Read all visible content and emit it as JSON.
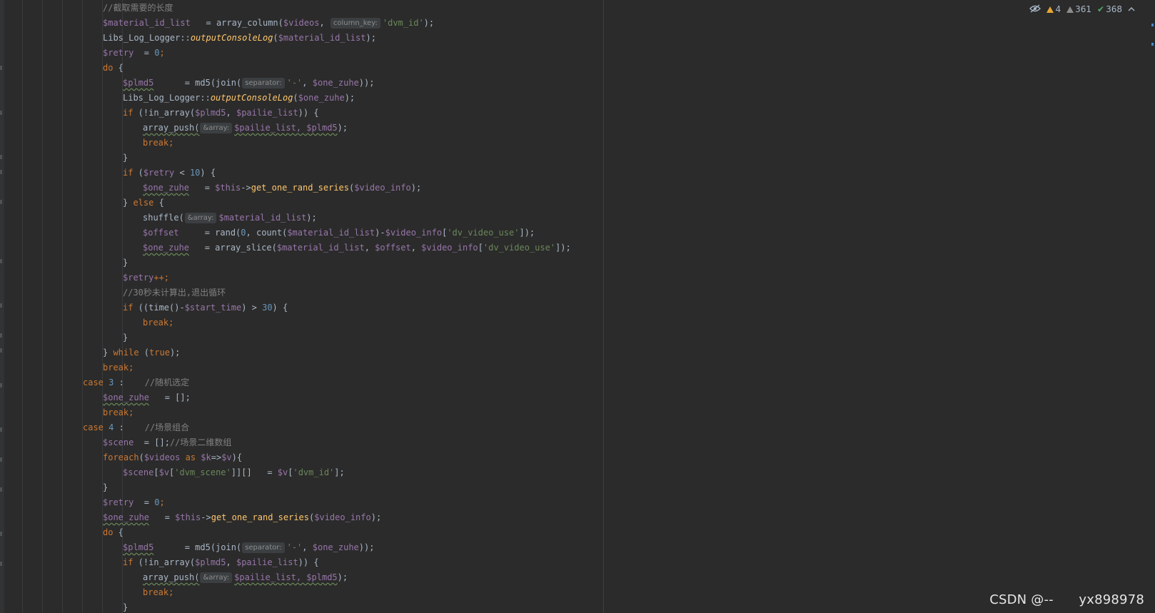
{
  "inspection_widget": {
    "warnings_count": "4",
    "weak_warnings_count": "361",
    "typos_count": "368"
  },
  "watermark": "CSDN @--      yx898978",
  "colors": {
    "background": "#2b2b2b",
    "variable": "#9876aa",
    "keyword": "#cc7832",
    "string": "#6a8759",
    "number": "#6897bb",
    "function": "#ffc66d",
    "comment": "#808080",
    "default": "#a9b7c6"
  },
  "code_lines": [
    [
      {
        "t": "//截取需要的长度",
        "c": "cmt"
      }
    ],
    [
      {
        "t": "$material_id_list",
        "c": "var"
      },
      {
        "t": "   = array_column(",
        "c": "plain"
      },
      {
        "t": "$videos",
        "c": "var"
      },
      {
        "t": ", ",
        "c": "plain"
      },
      {
        "t": "column_key:",
        "c": "hint"
      },
      {
        "t": "'dvm_id'",
        "c": "str"
      },
      {
        "t": ");",
        "c": "plain"
      }
    ],
    [
      {
        "t": "Libs_Log_Logger::",
        "c": "plain"
      },
      {
        "t": "outputConsoleLog",
        "c": "sfn"
      },
      {
        "t": "(",
        "c": "plain"
      },
      {
        "t": "$material_id_list",
        "c": "var"
      },
      {
        "t": ");",
        "c": "plain"
      }
    ],
    [
      {
        "t": "$retry",
        "c": "var"
      },
      {
        "t": "  = ",
        "c": "plain"
      },
      {
        "t": "0",
        "c": "num"
      },
      {
        "t": ";",
        "c": "kw"
      }
    ],
    [
      {
        "t": "do",
        "c": "kw"
      },
      {
        "t": " {",
        "c": "plain"
      }
    ],
    [
      {
        "t": "$plmd5",
        "c": "var wavy"
      },
      {
        "t": "      = md5(join(",
        "c": "plain"
      },
      {
        "t": "separator:",
        "c": "hint"
      },
      {
        "t": "'-'",
        "c": "str"
      },
      {
        "t": ", ",
        "c": "plain"
      },
      {
        "t": "$one_zuhe",
        "c": "var"
      },
      {
        "t": "));",
        "c": "plain"
      }
    ],
    [
      {
        "t": "Libs_Log_Logger::",
        "c": "plain"
      },
      {
        "t": "outputConsoleLog",
        "c": "sfn"
      },
      {
        "t": "(",
        "c": "plain"
      },
      {
        "t": "$one_zuhe",
        "c": "var"
      },
      {
        "t": ");",
        "c": "plain"
      }
    ],
    [
      {
        "t": "if",
        "c": "kw"
      },
      {
        "t": " (!in_array(",
        "c": "plain"
      },
      {
        "t": "$plmd5",
        "c": "var"
      },
      {
        "t": ", ",
        "c": "plain"
      },
      {
        "t": "$pailie_list",
        "c": "var"
      },
      {
        "t": ")) {",
        "c": "plain"
      }
    ],
    [
      {
        "t": "array_push(",
        "c": "plain wavy"
      },
      {
        "t": "&array:",
        "c": "hint"
      },
      {
        "t": "$pailie_list, $plmd5",
        "c": "var wavy"
      },
      {
        "t": ");",
        "c": "plain"
      }
    ],
    [
      {
        "t": "break;",
        "c": "kw"
      }
    ],
    [
      {
        "t": "}",
        "c": "plain"
      }
    ],
    [
      {
        "t": "if",
        "c": "kw"
      },
      {
        "t": " (",
        "c": "plain"
      },
      {
        "t": "$retry",
        "c": "var"
      },
      {
        "t": " < ",
        "c": "plain"
      },
      {
        "t": "10",
        "c": "num"
      },
      {
        "t": ") {",
        "c": "plain"
      }
    ],
    [
      {
        "t": "$one_zuhe",
        "c": "var wavy"
      },
      {
        "t": "   = ",
        "c": "plain"
      },
      {
        "t": "$this",
        "c": "var"
      },
      {
        "t": "->",
        "c": "plain"
      },
      {
        "t": "get_one_rand_series",
        "c": "fn"
      },
      {
        "t": "(",
        "c": "plain"
      },
      {
        "t": "$video_info",
        "c": "var"
      },
      {
        "t": ");",
        "c": "plain"
      }
    ],
    [
      {
        "t": "} ",
        "c": "plain"
      },
      {
        "t": "else",
        "c": "kw"
      },
      {
        "t": " {",
        "c": "plain"
      }
    ],
    [
      {
        "t": "shuffle(",
        "c": "plain"
      },
      {
        "t": "&array:",
        "c": "hint"
      },
      {
        "t": "$material_id_list",
        "c": "var"
      },
      {
        "t": ");",
        "c": "plain"
      }
    ],
    [
      {
        "t": "$offset",
        "c": "var"
      },
      {
        "t": "     = rand(",
        "c": "plain"
      },
      {
        "t": "0",
        "c": "num"
      },
      {
        "t": ", count(",
        "c": "plain"
      },
      {
        "t": "$material_id_list",
        "c": "var"
      },
      {
        "t": ")-",
        "c": "plain"
      },
      {
        "t": "$video_info",
        "c": "var"
      },
      {
        "t": "[",
        "c": "plain"
      },
      {
        "t": "'dv_video_use'",
        "c": "str"
      },
      {
        "t": "]);",
        "c": "plain"
      }
    ],
    [
      {
        "t": "$one_zuhe",
        "c": "var wavy"
      },
      {
        "t": "   = array_slice(",
        "c": "plain"
      },
      {
        "t": "$material_id_list",
        "c": "var"
      },
      {
        "t": ", ",
        "c": "plain"
      },
      {
        "t": "$offset",
        "c": "var"
      },
      {
        "t": ", ",
        "c": "plain"
      },
      {
        "t": "$video_info",
        "c": "var"
      },
      {
        "t": "[",
        "c": "plain"
      },
      {
        "t": "'dv_video_use'",
        "c": "str"
      },
      {
        "t": "]);",
        "c": "plain"
      }
    ],
    [
      {
        "t": "}",
        "c": "plain"
      }
    ],
    [
      {
        "t": "$retry",
        "c": "var"
      },
      {
        "t": "++;",
        "c": "kw"
      }
    ],
    [
      {
        "t": "//30秒未计算出,退出循环",
        "c": "cmt"
      }
    ],
    [
      {
        "t": "if",
        "c": "kw"
      },
      {
        "t": " ((time()-",
        "c": "plain"
      },
      {
        "t": "$start_time",
        "c": "var"
      },
      {
        "t": ") > ",
        "c": "plain"
      },
      {
        "t": "30",
        "c": "num"
      },
      {
        "t": ") {",
        "c": "plain"
      }
    ],
    [
      {
        "t": "break;",
        "c": "kw"
      }
    ],
    [
      {
        "t": "}",
        "c": "plain"
      }
    ],
    [
      {
        "t": "} ",
        "c": "plain"
      },
      {
        "t": "while",
        "c": "kw"
      },
      {
        "t": " (",
        "c": "plain"
      },
      {
        "t": "true",
        "c": "kw"
      },
      {
        "t": ");",
        "c": "plain"
      }
    ],
    [
      {
        "t": "break;",
        "c": "kw"
      }
    ],
    [
      {
        "t": "case",
        "c": "kw"
      },
      {
        "t": " ",
        "c": "plain"
      },
      {
        "t": "3",
        "c": "num"
      },
      {
        "t": " :    ",
        "c": "plain"
      },
      {
        "t": "//随机选定",
        "c": "cmt"
      }
    ],
    [
      {
        "t": "$one_zuhe",
        "c": "var wavy"
      },
      {
        "t": "   = [];",
        "c": "plain"
      }
    ],
    [
      {
        "t": "break;",
        "c": "kw"
      }
    ],
    [
      {
        "t": "case",
        "c": "kw"
      },
      {
        "t": " ",
        "c": "plain"
      },
      {
        "t": "4",
        "c": "num"
      },
      {
        "t": " :    ",
        "c": "plain"
      },
      {
        "t": "//场景组合",
        "c": "cmt"
      }
    ],
    [
      {
        "t": "$scene",
        "c": "var"
      },
      {
        "t": "  = [];",
        "c": "plain"
      },
      {
        "t": "//场景二维数组",
        "c": "cmt"
      }
    ],
    [
      {
        "t": "foreach",
        "c": "kw"
      },
      {
        "t": "(",
        "c": "plain"
      },
      {
        "t": "$videos",
        "c": "var"
      },
      {
        "t": " as ",
        "c": "kw"
      },
      {
        "t": "$k",
        "c": "var"
      },
      {
        "t": "=>",
        "c": "plain"
      },
      {
        "t": "$v",
        "c": "var"
      },
      {
        "t": "){",
        "c": "plain"
      }
    ],
    [
      {
        "t": "$scene",
        "c": "var"
      },
      {
        "t": "[",
        "c": "plain"
      },
      {
        "t": "$v",
        "c": "var"
      },
      {
        "t": "[",
        "c": "plain"
      },
      {
        "t": "'dvm_scene'",
        "c": "str"
      },
      {
        "t": "]][]   = ",
        "c": "plain"
      },
      {
        "t": "$v",
        "c": "var"
      },
      {
        "t": "[",
        "c": "plain"
      },
      {
        "t": "'dvm_id'",
        "c": "str"
      },
      {
        "t": "];",
        "c": "plain"
      }
    ],
    [
      {
        "t": "}",
        "c": "plain"
      }
    ],
    [
      {
        "t": "$retry",
        "c": "var"
      },
      {
        "t": "  = ",
        "c": "plain"
      },
      {
        "t": "0",
        "c": "num"
      },
      {
        "t": ";",
        "c": "kw"
      }
    ],
    [
      {
        "t": "$one_zuhe",
        "c": "var wavy"
      },
      {
        "t": "   = ",
        "c": "plain"
      },
      {
        "t": "$this",
        "c": "var"
      },
      {
        "t": "->",
        "c": "plain"
      },
      {
        "t": "get_one_rand_series",
        "c": "fn"
      },
      {
        "t": "(",
        "c": "plain"
      },
      {
        "t": "$video_info",
        "c": "var"
      },
      {
        "t": ");",
        "c": "plain"
      }
    ],
    [
      {
        "t": "do",
        "c": "kw"
      },
      {
        "t": " {",
        "c": "plain"
      }
    ],
    [
      {
        "t": "$plmd5",
        "c": "var wavy"
      },
      {
        "t": "      = md5(join(",
        "c": "plain"
      },
      {
        "t": "separator:",
        "c": "hint"
      },
      {
        "t": "'-'",
        "c": "str"
      },
      {
        "t": ", ",
        "c": "plain"
      },
      {
        "t": "$one_zuhe",
        "c": "var"
      },
      {
        "t": "));",
        "c": "plain"
      }
    ],
    [
      {
        "t": "if",
        "c": "kw"
      },
      {
        "t": " (!in_array(",
        "c": "plain"
      },
      {
        "t": "$plmd5",
        "c": "var"
      },
      {
        "t": ", ",
        "c": "plain"
      },
      {
        "t": "$pailie_list",
        "c": "var"
      },
      {
        "t": ")) {",
        "c": "plain"
      }
    ],
    [
      {
        "t": "array_push(",
        "c": "plain wavy"
      },
      {
        "t": "&array:",
        "c": "hint"
      },
      {
        "t": "$pailie_list, $plmd5",
        "c": "var wavy"
      },
      {
        "t": ");",
        "c": "plain"
      }
    ],
    [
      {
        "t": "break;",
        "c": "kw"
      }
    ],
    [
      {
        "t": "}",
        "c": "plain"
      }
    ]
  ]
}
